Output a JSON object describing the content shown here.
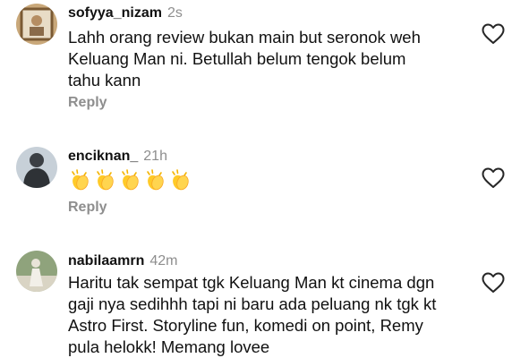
{
  "comments": [
    {
      "username": "sofyya_nizam",
      "time": "2s",
      "text_lines": [
        "Lahh orang review bukan main but seronok weh",
        "Keluang Man ni. Betullah belum tengok belum",
        "tahu kann"
      ],
      "reply_label": "Reply"
    },
    {
      "username": "enciknan_",
      "time": "21h",
      "emoji": [
        "clapping-hands",
        "clapping-hands",
        "clapping-hands",
        "clapping-hands",
        "clapping-hands"
      ],
      "reply_label": "Reply"
    },
    {
      "username": "nabilaamrn",
      "time": "42m",
      "text_lines": [
        "Haritu tak sempat tgk Keluang Man kt cinema dgn",
        "gaji nya sedihhh tapi ni baru ada peluang nk tgk kt",
        "Astro First. Storyline fun, komedi on point, Remy",
        "pula helokk! Memang lovee"
      ]
    }
  ],
  "colors": {
    "text": "#111111",
    "secondary": "#8e8e8e",
    "heart_outline": "#262626"
  },
  "icons": {
    "like": "heart-outline-icon"
  }
}
